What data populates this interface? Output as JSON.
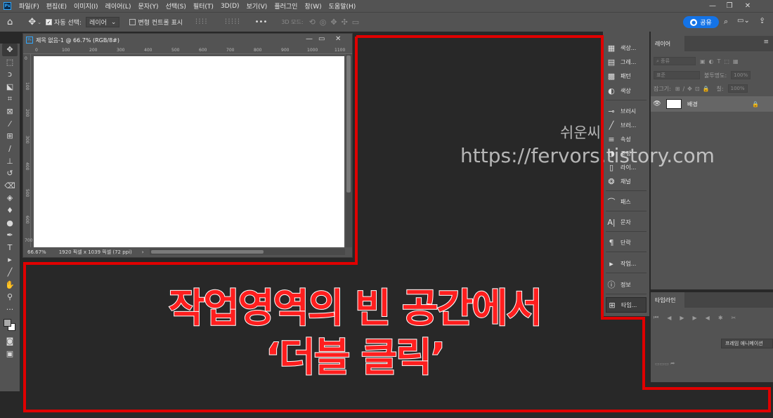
{
  "menu": {
    "items": [
      "파일(F)",
      "편집(E)",
      "이미지(I)",
      "레이어(L)",
      "문자(Y)",
      "선택(S)",
      "필터(T)",
      "3D(D)",
      "보기(V)",
      "플러그인",
      "창(W)",
      "도움말(H)"
    ]
  },
  "options_bar": {
    "auto_select_label": "자동 선택:",
    "auto_select_value": "레이어",
    "transform_controls_label": "변형 컨트롤 표시",
    "mode_3d_label": "3D 모드:",
    "more": "•••",
    "share_label": "공유"
  },
  "document": {
    "title": "제목 없음-1 @ 66.7% (RGB/8#)",
    "zoom": "66.67%",
    "size_info": "1920 픽셀 x 1039 픽셀 (72 ppi)",
    "ruler_h": [
      "0",
      "100",
      "200",
      "300",
      "400",
      "500",
      "600",
      "700",
      "800",
      "900",
      "1000",
      "1100"
    ],
    "ruler_v": [
      "0",
      "100",
      "200",
      "300",
      "400",
      "500",
      "600",
      "700"
    ]
  },
  "dock": {
    "items": [
      {
        "icon": "swatches-icon",
        "glyph": "▦",
        "label": "색상..."
      },
      {
        "icon": "gradient-icon",
        "glyph": "▤",
        "label": "그레..."
      },
      {
        "icon": "pattern-icon",
        "glyph": "▩",
        "label": "패턴"
      },
      {
        "icon": "color-icon",
        "glyph": "◐",
        "label": "색상"
      },
      {
        "icon": "brushes-icon",
        "glyph": "⊸",
        "label": "브러시"
      },
      {
        "icon": "brush-settings-icon",
        "glyph": "╱",
        "label": "브러..."
      },
      {
        "icon": "properties-icon",
        "glyph": "≡",
        "label": "속성"
      },
      {
        "icon": "adjustments-icon",
        "glyph": "◑",
        "label": "조정"
      },
      {
        "icon": "libraries-icon",
        "glyph": "▯",
        "label": "라이..."
      },
      {
        "icon": "channels-icon",
        "glyph": "❂",
        "label": "채널"
      },
      {
        "icon": "paths-icon",
        "glyph": "⌒",
        "label": "패스"
      },
      {
        "icon": "character-icon",
        "glyph": "A|",
        "label": "문자"
      },
      {
        "icon": "paragraph-icon",
        "glyph": "¶",
        "label": "단락"
      },
      {
        "icon": "actions-icon",
        "glyph": "▸",
        "label": "작업..."
      },
      {
        "icon": "info-icon",
        "glyph": "ⓘ",
        "label": "정보"
      },
      {
        "icon": "timeline-icon",
        "glyph": "⊞",
        "label": "타임..."
      }
    ]
  },
  "layers": {
    "tab": "레이어",
    "kind_filter": "종류",
    "blend_mode": "표준",
    "opacity_label": "불투명도:",
    "opacity_value": "100%",
    "lock_label": "잠그기:",
    "fill_label": "칠:",
    "fill_value": "100%",
    "layer_name": "배경"
  },
  "timeline": {
    "tab": "타임라인",
    "frame_button": "프레임 애니메이션"
  },
  "watermark": {
    "line1": "쉬운씨",
    "line2": "https://fervors.tistory.com"
  },
  "annotation": {
    "line1": "작업영역의 빈 공간에서",
    "line2": "‘더블 클릭’",
    "color": "#ff1e1e",
    "outline_color": "#e00000"
  },
  "colors": {
    "ui_panel": "#535353",
    "workspace": "#282828",
    "accent": "#1473e6"
  }
}
